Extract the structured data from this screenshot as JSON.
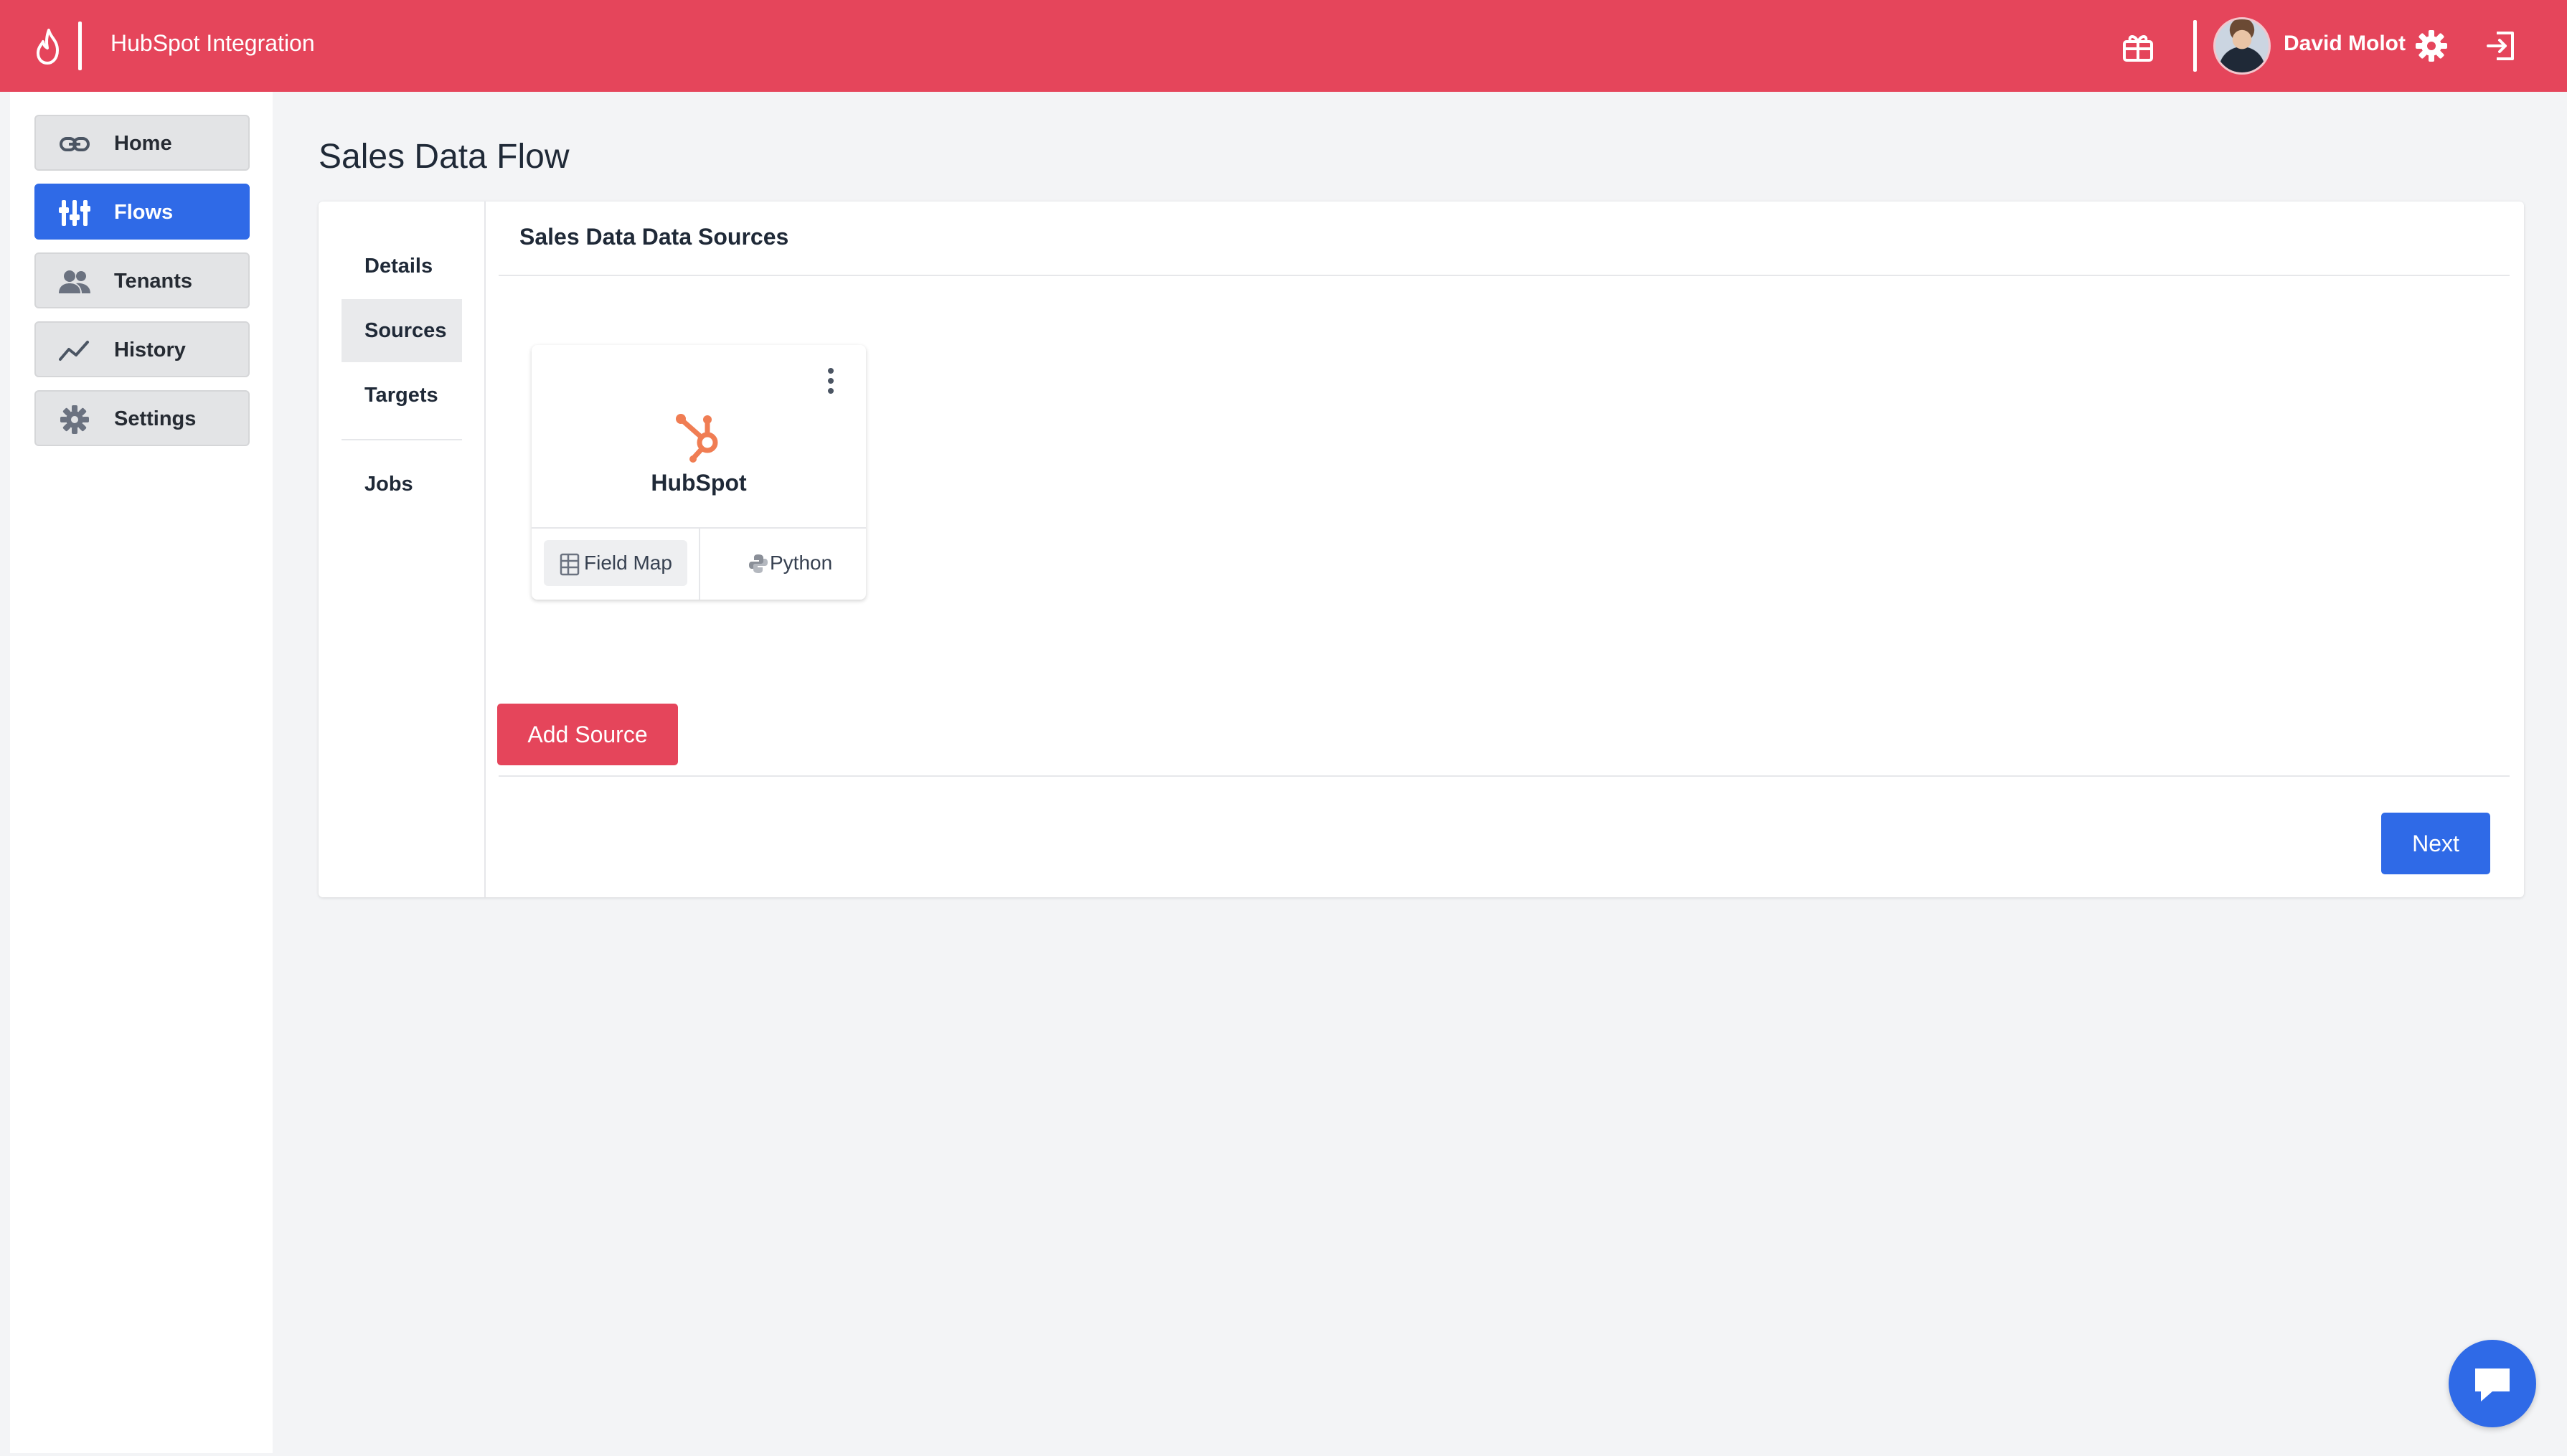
{
  "app": {
    "title": "HubSpot Integration"
  },
  "header": {
    "user_name": "David Molot"
  },
  "sidebar": {
    "items": [
      {
        "label": "Home",
        "icon": "link-icon",
        "active": false
      },
      {
        "label": "Flows",
        "icon": "flows-icon",
        "active": true
      },
      {
        "label": "Tenants",
        "icon": "users-icon",
        "active": false
      },
      {
        "label": "History",
        "icon": "chart-line-icon",
        "active": false
      },
      {
        "label": "Settings",
        "icon": "gear-icon",
        "active": false
      }
    ]
  },
  "page": {
    "title": "Sales Data Flow"
  },
  "tabs": [
    {
      "label": "Details",
      "active": false
    },
    {
      "label": "Sources",
      "active": true
    },
    {
      "label": "Targets",
      "active": false
    },
    {
      "label": "Jobs",
      "active": false
    }
  ],
  "section": {
    "title": "Sales Data Data Sources"
  },
  "source_card": {
    "name": "HubSpot",
    "field_map_label": "Field Map",
    "python_label": "Python"
  },
  "buttons": {
    "add_source": "Add Source",
    "next": "Next"
  },
  "colors": {
    "brand_red": "#e5455b",
    "primary_blue": "#2f6ae7",
    "hubspot_orange": "#f07d53"
  }
}
